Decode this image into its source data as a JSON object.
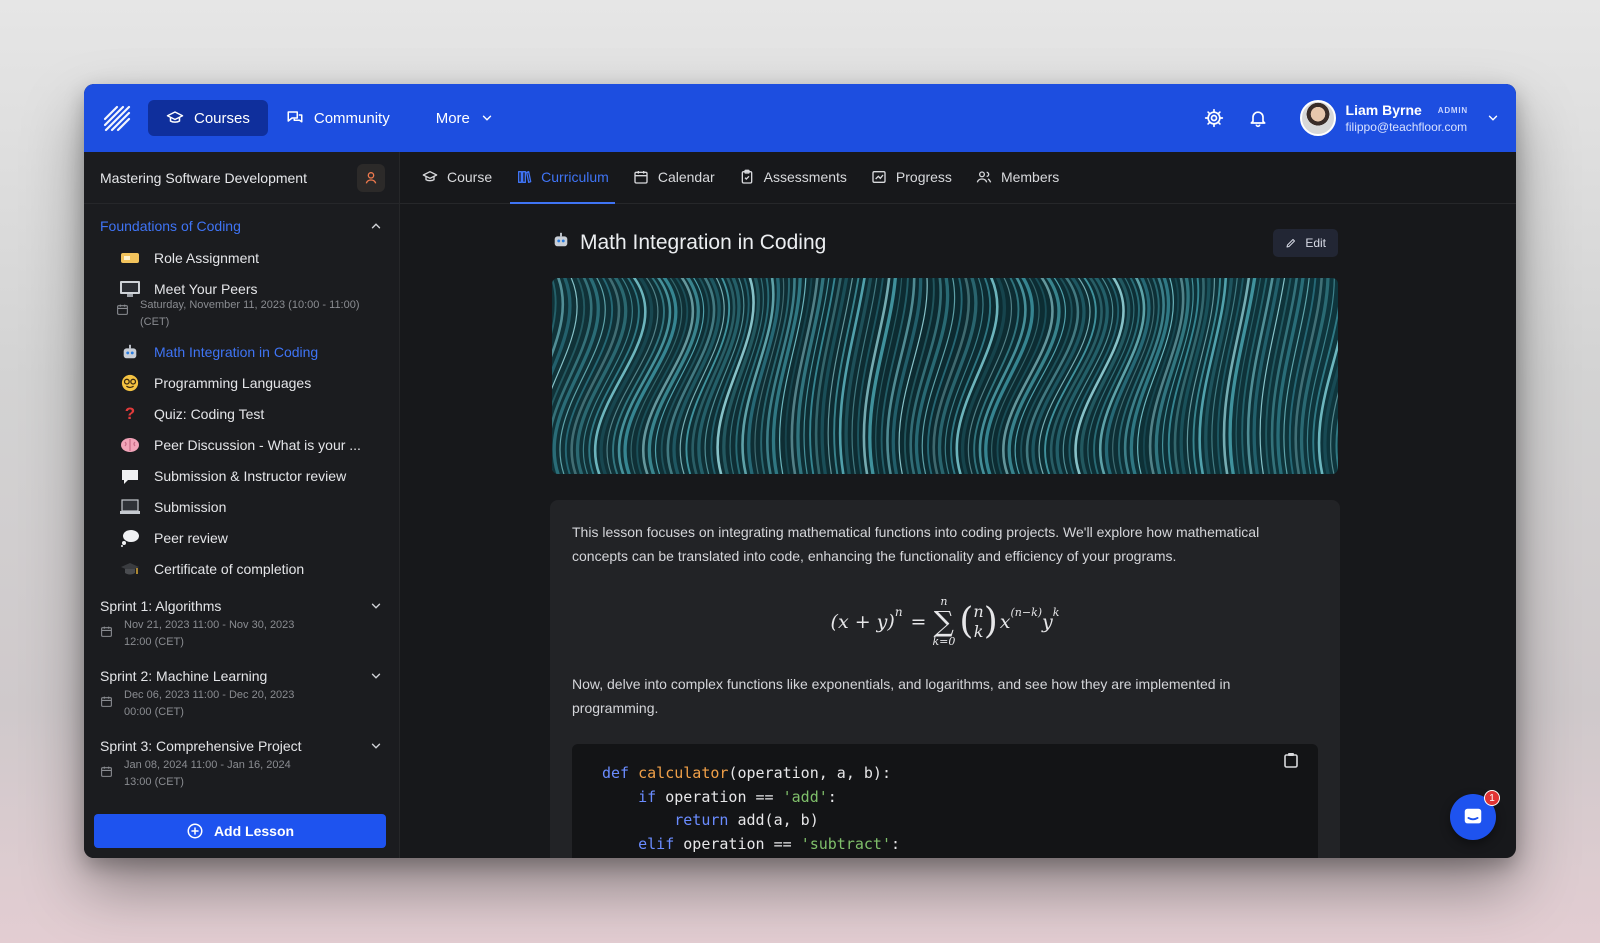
{
  "topbar": {
    "nav": [
      {
        "label": "Courses",
        "icon": "graduation-cap-icon",
        "active": true
      },
      {
        "label": "Community",
        "icon": "chat-bubbles-icon",
        "active": false
      },
      {
        "label": "More",
        "icon": "chevron-down-icon",
        "active": false
      }
    ],
    "user": {
      "name": "Liam Byrne",
      "role": "ADMIN",
      "email": "filippo@teachfloor.com"
    }
  },
  "sidebar": {
    "course_title": "Mastering Software Development",
    "section": {
      "title": "Foundations of Coding",
      "expanded": true
    },
    "lessons": [
      {
        "label": "Role Assignment",
        "icon": "ticket-icon"
      },
      {
        "label": "Meet Your Peers",
        "icon": "monitor-icon",
        "sub": "Saturday, November 11, 2023 (10:00 - 11:00) (CET)"
      },
      {
        "label": "Math Integration in Coding",
        "icon": "robot-icon",
        "active": true
      },
      {
        "label": "Programming Languages",
        "icon": "nerd-face-icon"
      },
      {
        "label": "Quiz: Coding Test",
        "icon": "question-mark-icon"
      },
      {
        "label": "Peer Discussion - What is your ...",
        "icon": "brain-icon"
      },
      {
        "label": "Submission & Instructor review",
        "icon": "speech-bubble-icon"
      },
      {
        "label": "Submission",
        "icon": "laptop-icon"
      },
      {
        "label": "Peer review",
        "icon": "thought-bubble-icon"
      },
      {
        "label": "Certificate of completion",
        "icon": "graduation-hat-icon"
      }
    ],
    "sprints": [
      {
        "title": "Sprint 1: Algorithms",
        "line1": "Nov 21, 2023 11:00 - Nov 30, 2023",
        "line2": "12:00 (CET)"
      },
      {
        "title": "Sprint 2: Machine Learning",
        "line1": "Dec 06, 2023 11:00 - Dec 20, 2023",
        "line2": "00:00 (CET)"
      },
      {
        "title": "Sprint 3: Comprehensive Project",
        "line1": "Jan 08, 2024 11:00 - Jan 16, 2024",
        "line2": "13:00 (CET)"
      }
    ],
    "add_lesson_label": "Add Lesson"
  },
  "tabs": [
    {
      "label": "Course",
      "icon": "graduation-cap-icon"
    },
    {
      "label": "Curriculum",
      "icon": "books-icon",
      "active": true
    },
    {
      "label": "Calendar",
      "icon": "calendar-icon"
    },
    {
      "label": "Assessments",
      "icon": "clipboard-icon"
    },
    {
      "label": "Progress",
      "icon": "chart-icon"
    },
    {
      "label": "Members",
      "icon": "users-icon"
    }
  ],
  "lesson": {
    "title": "Math Integration in Coding",
    "edit_label": "Edit",
    "para1": "This lesson focuses on integrating mathematical functions into coding projects. We'll explore how mathematical concepts can be translated into code, enhancing the functionality and efficiency of your programs.",
    "para2": "Now, delve into complex functions like exponentials, and logarithms, and see how they are implemented in programming.",
    "formula": {
      "lhs": "(x + y)",
      "lhs_exp": "n",
      "equals": "=",
      "sum_top": "n",
      "sum_bottom": "k=0",
      "binom_top": "n",
      "binom_bottom": "k",
      "term_base1": "x",
      "term_exp1": "(n−k)",
      "term_base2": "y",
      "term_exp2": "k"
    },
    "code": {
      "l1_kw": "def",
      "l1_fn": "calculator",
      "l1_rest": "(operation, a, b):",
      "l2_kw": "if",
      "l2_mid": " operation == ",
      "l2_str": "'add'",
      "l2_end": ":",
      "l3_kw": "return",
      "l3_rest": " add(a, b)",
      "l4_kw": "elif",
      "l4_mid": " operation == ",
      "l4_str": "'subtract'",
      "l4_end": ":"
    }
  },
  "chat": {
    "badge": "1"
  },
  "colors": {
    "accent": "#1d4ee0",
    "active_text": "#3f74f5",
    "background": "#17181b"
  }
}
